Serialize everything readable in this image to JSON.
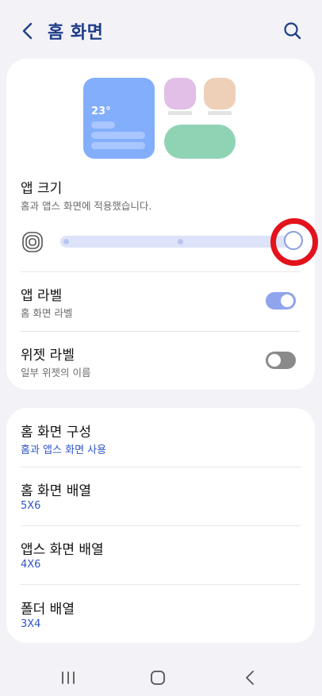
{
  "header": {
    "title": "홈 화면"
  },
  "preview": {
    "temperature": "23°"
  },
  "app_size": {
    "title": "앱 크기",
    "subtitle": "홈과 앱스 화면에 적용했습니다.",
    "slider_value_percent": 100
  },
  "app_label": {
    "title": "앱 라벨",
    "subtitle": "홈 화면 라벨",
    "enabled": true
  },
  "widget_label": {
    "title": "위젯 라벨",
    "subtitle": "일부 위젯의 이름",
    "enabled": false
  },
  "settings": [
    {
      "title": "홈 화면 구성",
      "value": "홈과 앱스 화면 사용"
    },
    {
      "title": "홈 화면 배열",
      "value": "5X6"
    },
    {
      "title": "앱스 화면 배열",
      "value": "4X6"
    },
    {
      "title": "폴더 배열",
      "value": "3X4"
    }
  ],
  "colors": {
    "title": "#1f3c88",
    "accent": "#2f55c9",
    "highlight": "#e3121c"
  }
}
